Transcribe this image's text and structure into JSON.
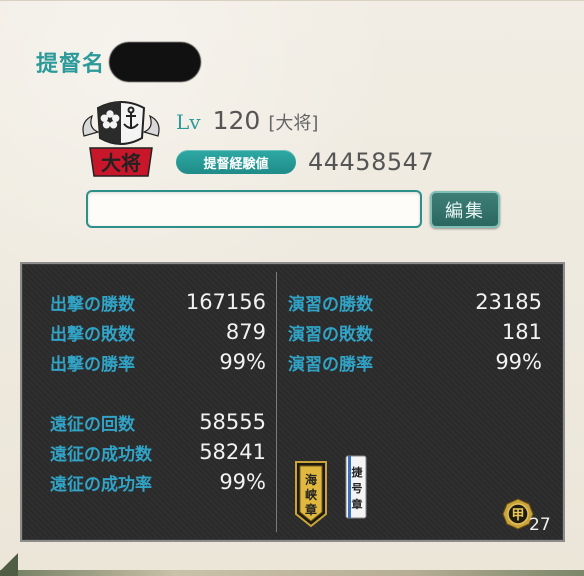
{
  "profile": {
    "name_label": "提督名",
    "level_label": "Lv",
    "level": "120",
    "rank": "[大将]",
    "rank_emblem_text": "大将",
    "exp_label": "提督経験値",
    "exp_value": "44458547",
    "comment_value": "",
    "edit_label": "編集"
  },
  "stats": {
    "sortie": [
      {
        "label": "出撃の勝数",
        "value": "167156"
      },
      {
        "label": "出撃の敗数",
        "value": "879"
      },
      {
        "label": "出撃の勝率",
        "value": "99%"
      }
    ],
    "exercise": [
      {
        "label": "演習の勝数",
        "value": "23185"
      },
      {
        "label": "演習の敗数",
        "value": "181"
      },
      {
        "label": "演習の勝率",
        "value": "99%"
      }
    ],
    "expedition": [
      {
        "label": "遠征の回数",
        "value": "58555"
      },
      {
        "label": "遠征の成功数",
        "value": "58241"
      },
      {
        "label": "遠征の成功率",
        "value": "99%"
      }
    ]
  },
  "medals": {
    "strait_medal_text": "海峡章",
    "sortie_medal_text": "捷号章",
    "kou_medal_text": "甲",
    "kou_medal_count": "27"
  },
  "colors": {
    "accent_teal": "#2c9a9a",
    "stat_label_blue": "#31a3c6",
    "panel_bg": "#2a2a2a"
  }
}
